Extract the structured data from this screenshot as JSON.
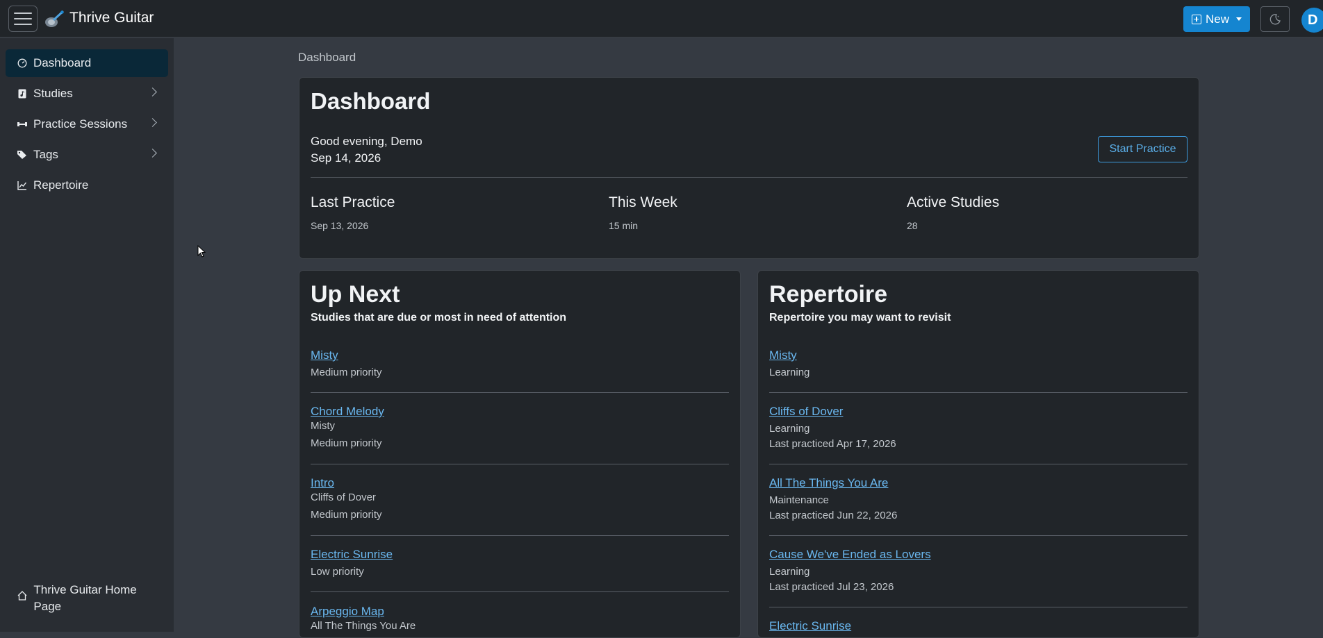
{
  "navbar": {
    "brand": "Thrive Guitar",
    "new_label": "New",
    "avatar_initial": "D"
  },
  "sidebar": {
    "items": [
      {
        "label": "Dashboard",
        "icon": "gauge-icon"
      },
      {
        "label": "Studies",
        "icon": "file-music-icon"
      },
      {
        "label": "Practice Sessions",
        "icon": "dumbbell-icon"
      },
      {
        "label": "Tags",
        "icon": "tags-icon"
      },
      {
        "label": "Repertoire",
        "icon": "chart-line-icon"
      }
    ],
    "home_label": "Thrive Guitar Home Page"
  },
  "breadcrumb": "Dashboard",
  "dashboard": {
    "title": "Dashboard",
    "greeting": "Good evening, Demo",
    "date": "Sep 14, 2026",
    "start_label": "Start Practice",
    "stats": [
      {
        "title": "Last Practice",
        "value": "Sep 13, 2026"
      },
      {
        "title": "This Week",
        "value": "15 min"
      },
      {
        "title": "Active Studies",
        "value": "28"
      }
    ]
  },
  "up_next": {
    "title": "Up Next",
    "subtitle": "Studies that are due or most in need of attention",
    "items": [
      {
        "name": "Misty",
        "lines": [
          "Medium priority"
        ]
      },
      {
        "name": "Chord Melody",
        "lines": [
          "Misty",
          "Medium priority"
        ]
      },
      {
        "name": "Intro",
        "lines": [
          "Cliffs of Dover",
          "Medium priority"
        ]
      },
      {
        "name": "Electric Sunrise",
        "lines": [
          "Low priority"
        ]
      },
      {
        "name": "Arpeggio Map",
        "lines": [
          "All The Things You Are"
        ]
      }
    ]
  },
  "repertoire": {
    "title": "Repertoire",
    "subtitle": "Repertoire you may want to revisit",
    "items": [
      {
        "name": "Misty",
        "lines": [
          "Learning"
        ]
      },
      {
        "name": "Cliffs of Dover",
        "lines": [
          "Learning",
          "Last practiced Apr 17, 2026"
        ]
      },
      {
        "name": "All The Things You Are",
        "lines": [
          "Maintenance",
          "Last practiced Jun 22, 2026"
        ]
      },
      {
        "name": "Cause We've Ended as Lovers",
        "lines": [
          "Learning",
          "Last practiced Jul 23, 2026"
        ]
      },
      {
        "name": "Electric Sunrise",
        "lines": []
      }
    ]
  },
  "colors": {
    "accent": "#1585d0",
    "link": "#6ab8f0",
    "sidebar_active": "#0a2838"
  }
}
